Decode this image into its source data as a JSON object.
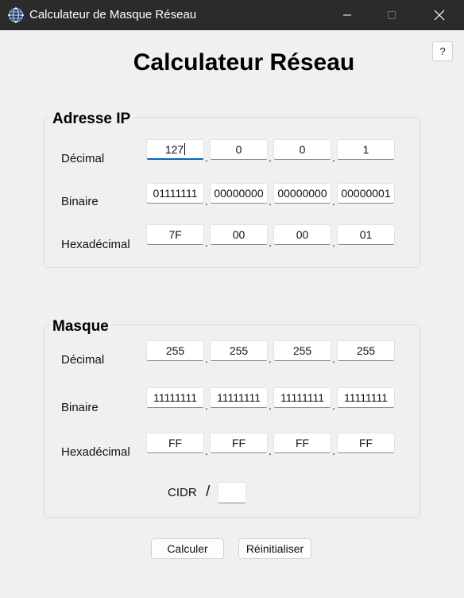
{
  "window": {
    "title": "Calculateur de Masque Réseau",
    "icon": "network-globe-icon"
  },
  "help_label": "?",
  "main_title": "Calculateur Réseau",
  "ip_group": {
    "legend": "Adresse IP",
    "decimal_label": "Décimal",
    "binary_label": "Binaire",
    "hex_label": "Hexadécimal",
    "decimal": [
      "127",
      "0",
      "0",
      "1"
    ],
    "binary": [
      "01111111",
      "00000000",
      "00000000",
      "00000001"
    ],
    "hex": [
      "7F",
      "00",
      "00",
      "01"
    ]
  },
  "mask_group": {
    "legend": "Masque",
    "decimal_label": "Décimal",
    "binary_label": "Binaire",
    "hex_label": "Hexadécimal",
    "decimal": [
      "255",
      "255",
      "255",
      "255"
    ],
    "binary": [
      "11111111",
      "11111111",
      "11111111",
      "11111111"
    ],
    "hex": [
      "FF",
      "FF",
      "FF",
      "FF"
    ],
    "cidr_label": "CIDR",
    "cidr_separator": "/",
    "cidr_value": ""
  },
  "separator": ".",
  "buttons": {
    "calculate": "Calculer",
    "reset": "Réinitialiser"
  },
  "colors": {
    "titlebar": "#2b2b2b",
    "background": "#f0f0f0",
    "focus_accent": "#0067c0"
  }
}
